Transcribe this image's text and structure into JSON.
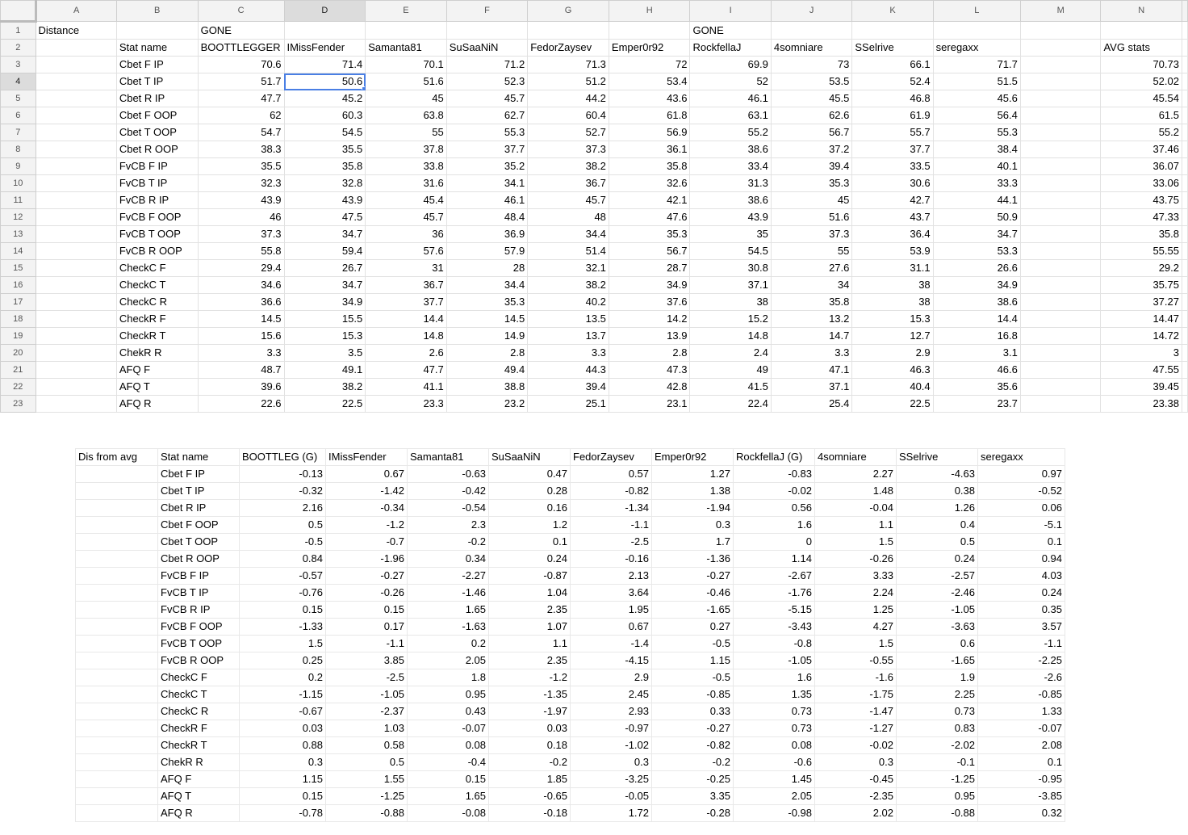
{
  "columns": [
    "A",
    "B",
    "C",
    "D",
    "E",
    "F",
    "G",
    "H",
    "I",
    "J",
    "K",
    "L",
    "M",
    "N"
  ],
  "rows": [
    [
      "Distance",
      "",
      "GONE",
      "",
      "",
      "",
      "",
      "",
      "GONE",
      "",
      "",
      "",
      "",
      ""
    ],
    [
      "",
      "Stat name",
      "BOOTTLEGGER",
      "IMissFender",
      "Samanta81",
      "SuSaaNiN",
      "FedorZaysev",
      "Emper0r92",
      "RockfellaJ",
      "4somniare",
      "SSelrive",
      "seregaxx",
      "",
      "AVG stats"
    ],
    [
      "",
      "Cbet F IP",
      "70.6",
      "71.4",
      "70.1",
      "71.2",
      "71.3",
      "72",
      "69.9",
      "73",
      "66.1",
      "71.7",
      "",
      "70.73"
    ],
    [
      "",
      "Cbet T IP",
      "51.7",
      "50.6",
      "51.6",
      "52.3",
      "51.2",
      "53.4",
      "52",
      "53.5",
      "52.4",
      "51.5",
      "",
      "52.02"
    ],
    [
      "",
      "Cbet R IP",
      "47.7",
      "45.2",
      "45",
      "45.7",
      "44.2",
      "43.6",
      "46.1",
      "45.5",
      "46.8",
      "45.6",
      "",
      "45.54"
    ],
    [
      "",
      "Cbet F OOP",
      "62",
      "60.3",
      "63.8",
      "62.7",
      "60.4",
      "61.8",
      "63.1",
      "62.6",
      "61.9",
      "56.4",
      "",
      "61.5"
    ],
    [
      "",
      "Cbet T OOP",
      "54.7",
      "54.5",
      "55",
      "55.3",
      "52.7",
      "56.9",
      "55.2",
      "56.7",
      "55.7",
      "55.3",
      "",
      "55.2"
    ],
    [
      "",
      "Cbet R OOP",
      "38.3",
      "35.5",
      "37.8",
      "37.7",
      "37.3",
      "36.1",
      "38.6",
      "37.2",
      "37.7",
      "38.4",
      "",
      "37.46"
    ],
    [
      "",
      "FvCB F IP",
      "35.5",
      "35.8",
      "33.8",
      "35.2",
      "38.2",
      "35.8",
      "33.4",
      "39.4",
      "33.5",
      "40.1",
      "",
      "36.07"
    ],
    [
      "",
      "FvCB T IP",
      "32.3",
      "32.8",
      "31.6",
      "34.1",
      "36.7",
      "32.6",
      "31.3",
      "35.3",
      "30.6",
      "33.3",
      "",
      "33.06"
    ],
    [
      "",
      "FvCB R IP",
      "43.9",
      "43.9",
      "45.4",
      "46.1",
      "45.7",
      "42.1",
      "38.6",
      "45",
      "42.7",
      "44.1",
      "",
      "43.75"
    ],
    [
      "",
      "FvCB F OOP",
      "46",
      "47.5",
      "45.7",
      "48.4",
      "48",
      "47.6",
      "43.9",
      "51.6",
      "43.7",
      "50.9",
      "",
      "47.33"
    ],
    [
      "",
      "FvCB T OOP",
      "37.3",
      "34.7",
      "36",
      "36.9",
      "34.4",
      "35.3",
      "35",
      "37.3",
      "36.4",
      "34.7",
      "",
      "35.8"
    ],
    [
      "",
      "FvCB R OOP",
      "55.8",
      "59.4",
      "57.6",
      "57.9",
      "51.4",
      "56.7",
      "54.5",
      "55",
      "53.9",
      "53.3",
      "",
      "55.55"
    ],
    [
      "",
      "CheckC F",
      "29.4",
      "26.7",
      "31",
      "28",
      "32.1",
      "28.7",
      "30.8",
      "27.6",
      "31.1",
      "26.6",
      "",
      "29.2"
    ],
    [
      "",
      "CheckC T",
      "34.6",
      "34.7",
      "36.7",
      "34.4",
      "38.2",
      "34.9",
      "37.1",
      "34",
      "38",
      "34.9",
      "",
      "35.75"
    ],
    [
      "",
      "CheckC R",
      "36.6",
      "34.9",
      "37.7",
      "35.3",
      "40.2",
      "37.6",
      "38",
      "35.8",
      "38",
      "38.6",
      "",
      "37.27"
    ],
    [
      "",
      "CheckR F",
      "14.5",
      "15.5",
      "14.4",
      "14.5",
      "13.5",
      "14.2",
      "15.2",
      "13.2",
      "15.3",
      "14.4",
      "",
      "14.47"
    ],
    [
      "",
      "CheckR T",
      "15.6",
      "15.3",
      "14.8",
      "14.9",
      "13.7",
      "13.9",
      "14.8",
      "14.7",
      "12.7",
      "16.8",
      "",
      "14.72"
    ],
    [
      "",
      "ChekR R",
      "3.3",
      "3.5",
      "2.6",
      "2.8",
      "3.3",
      "2.8",
      "2.4",
      "3.3",
      "2.9",
      "3.1",
      "",
      "3"
    ],
    [
      "",
      "AFQ F",
      "48.7",
      "49.1",
      "47.7",
      "49.4",
      "44.3",
      "47.3",
      "49",
      "47.1",
      "46.3",
      "46.6",
      "",
      "47.55"
    ],
    [
      "",
      "AFQ T",
      "39.6",
      "38.2",
      "41.1",
      "38.8",
      "39.4",
      "42.8",
      "41.5",
      "37.1",
      "40.4",
      "35.6",
      "",
      "39.45"
    ],
    [
      "",
      "AFQ R",
      "22.6",
      "22.5",
      "23.3",
      "23.2",
      "25.1",
      "23.1",
      "22.4",
      "25.4",
      "22.5",
      "23.7",
      "",
      "23.38"
    ]
  ],
  "selection": {
    "row": 4,
    "col": "D"
  },
  "dist_table": {
    "header": [
      "Dis from avg",
      "Stat name",
      "BOOTTLEG (G)",
      "IMissFender",
      "Samanta81",
      "SuSaaNiN",
      "FedorZaysev",
      "Emper0r92",
      "RockfellaJ (G)",
      "4somniare",
      "SSelrive",
      "seregaxx"
    ],
    "rows": [
      [
        "",
        "Cbet F IP",
        "-0.13",
        "0.67",
        "-0.63",
        "0.47",
        "0.57",
        "1.27",
        "-0.83",
        "2.27",
        "-4.63",
        "0.97"
      ],
      [
        "",
        "Cbet T IP",
        "-0.32",
        "-1.42",
        "-0.42",
        "0.28",
        "-0.82",
        "1.38",
        "-0.02",
        "1.48",
        "0.38",
        "-0.52"
      ],
      [
        "",
        "Cbet R IP",
        "2.16",
        "-0.34",
        "-0.54",
        "0.16",
        "-1.34",
        "-1.94",
        "0.56",
        "-0.04",
        "1.26",
        "0.06"
      ],
      [
        "",
        "Cbet F OOP",
        "0.5",
        "-1.2",
        "2.3",
        "1.2",
        "-1.1",
        "0.3",
        "1.6",
        "1.1",
        "0.4",
        "-5.1"
      ],
      [
        "",
        "Cbet T OOP",
        "-0.5",
        "-0.7",
        "-0.2",
        "0.1",
        "-2.5",
        "1.7",
        "0",
        "1.5",
        "0.5",
        "0.1"
      ],
      [
        "",
        "Cbet R OOP",
        "0.84",
        "-1.96",
        "0.34",
        "0.24",
        "-0.16",
        "-1.36",
        "1.14",
        "-0.26",
        "0.24",
        "0.94"
      ],
      [
        "",
        "FvCB F IP",
        "-0.57",
        "-0.27",
        "-2.27",
        "-0.87",
        "2.13",
        "-0.27",
        "-2.67",
        "3.33",
        "-2.57",
        "4.03"
      ],
      [
        "",
        "FvCB T IP",
        "-0.76",
        "-0.26",
        "-1.46",
        "1.04",
        "3.64",
        "-0.46",
        "-1.76",
        "2.24",
        "-2.46",
        "0.24"
      ],
      [
        "",
        "FvCB R IP",
        "0.15",
        "0.15",
        "1.65",
        "2.35",
        "1.95",
        "-1.65",
        "-5.15",
        "1.25",
        "-1.05",
        "0.35"
      ],
      [
        "",
        "FvCB F OOP",
        "-1.33",
        "0.17",
        "-1.63",
        "1.07",
        "0.67",
        "0.27",
        "-3.43",
        "4.27",
        "-3.63",
        "3.57"
      ],
      [
        "",
        "FvCB T OOP",
        "1.5",
        "-1.1",
        "0.2",
        "1.1",
        "-1.4",
        "-0.5",
        "-0.8",
        "1.5",
        "0.6",
        "-1.1"
      ],
      [
        "",
        "FvCB R OOP",
        "0.25",
        "3.85",
        "2.05",
        "2.35",
        "-4.15",
        "1.15",
        "-1.05",
        "-0.55",
        "-1.65",
        "-2.25"
      ],
      [
        "",
        "CheckC F",
        "0.2",
        "-2.5",
        "1.8",
        "-1.2",
        "2.9",
        "-0.5",
        "1.6",
        "-1.6",
        "1.9",
        "-2.6"
      ],
      [
        "",
        "CheckC T",
        "-1.15",
        "-1.05",
        "0.95",
        "-1.35",
        "2.45",
        "-0.85",
        "1.35",
        "-1.75",
        "2.25",
        "-0.85"
      ],
      [
        "",
        "CheckC R",
        "-0.67",
        "-2.37",
        "0.43",
        "-1.97",
        "2.93",
        "0.33",
        "0.73",
        "-1.47",
        "0.73",
        "1.33"
      ],
      [
        "",
        "CheckR F",
        "0.03",
        "1.03",
        "-0.07",
        "0.03",
        "-0.97",
        "-0.27",
        "0.73",
        "-1.27",
        "0.83",
        "-0.07"
      ],
      [
        "",
        "CheckR T",
        "0.88",
        "0.58",
        "0.08",
        "0.18",
        "-1.02",
        "-0.82",
        "0.08",
        "-0.02",
        "-2.02",
        "2.08"
      ],
      [
        "",
        "ChekR R",
        "0.3",
        "0.5",
        "-0.4",
        "-0.2",
        "0.3",
        "-0.2",
        "-0.6",
        "0.3",
        "-0.1",
        "0.1"
      ],
      [
        "",
        "AFQ F",
        "1.15",
        "1.55",
        "0.15",
        "1.85",
        "-3.25",
        "-0.25",
        "1.45",
        "-0.45",
        "-1.25",
        "-0.95"
      ],
      [
        "",
        "AFQ T",
        "0.15",
        "-1.25",
        "1.65",
        "-0.65",
        "-0.05",
        "3.35",
        "2.05",
        "-2.35",
        "0.95",
        "-3.85"
      ],
      [
        "",
        "AFQ R",
        "-0.78",
        "-0.88",
        "-0.08",
        "-0.18",
        "1.72",
        "-0.28",
        "-0.98",
        "2.02",
        "-0.88",
        "0.32"
      ]
    ]
  }
}
